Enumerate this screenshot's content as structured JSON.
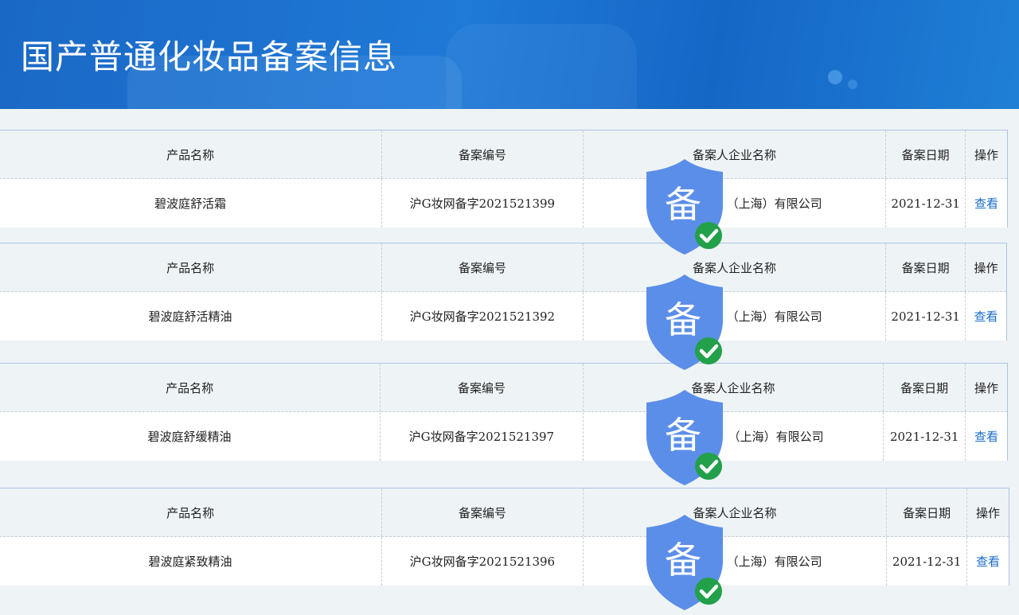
{
  "header": {
    "title": "国产普通化妆品备案信息"
  },
  "columns": [
    "产品名称",
    "备案编号",
    "备案人企业名称",
    "备案日期",
    "操作"
  ],
  "badge": {
    "char": "备",
    "shield_color": "#5b8ee8",
    "check_color": "#22a04a"
  },
  "records": [
    {
      "product": "碧波庭舒活霜",
      "number": "沪G妆网备字2021521399",
      "company": "（上海）有限公司",
      "date": "2021-12-31",
      "action": "查看"
    },
    {
      "product": "碧波庭舒活精油",
      "number": "沪G妆网备字2021521392",
      "company": "（上海）有限公司",
      "date": "2021-12-31",
      "action": "查看"
    },
    {
      "product": "碧波庭舒缓精油",
      "number": "沪G妆网备字2021521397",
      "company": "（上海）有限公司",
      "date": "2021-12-31",
      "action": "查看"
    },
    {
      "product": "碧波庭紧致精油",
      "number": "沪G妆网备字2021521396",
      "company": "（上海）有限公司",
      "date": "2021-12-31",
      "action": "查看"
    }
  ]
}
